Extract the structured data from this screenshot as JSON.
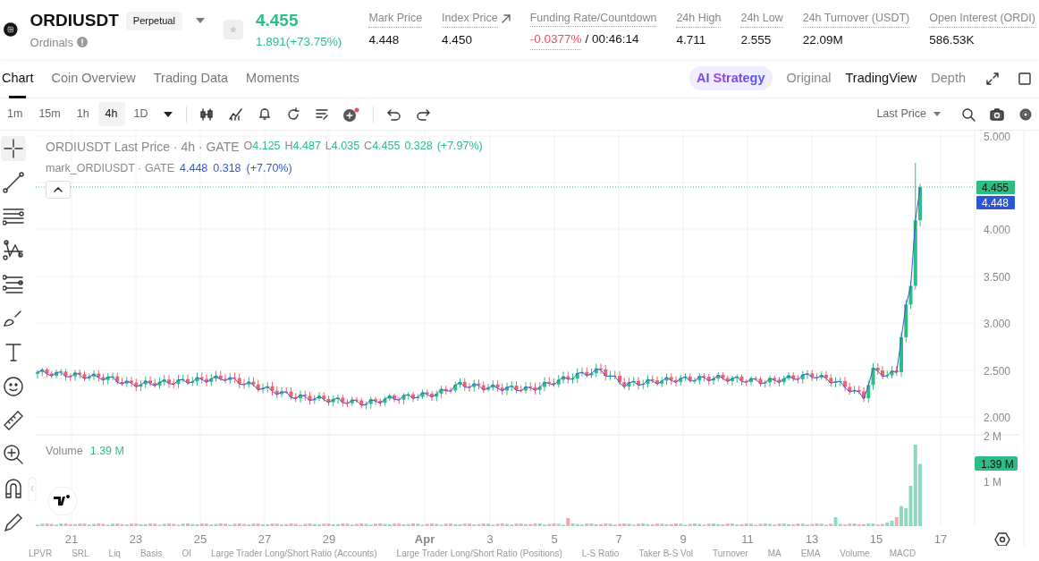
{
  "header": {
    "symbol": "ORDIUSDT",
    "badge": "Perpetual",
    "subtitle": "Ordinals",
    "price": "4.455",
    "change": "1.891(+73.75%)",
    "stats": [
      {
        "label": "Mark Price",
        "value": "4.448"
      },
      {
        "label": "Index Price",
        "value": "4.450",
        "kind": "link"
      },
      {
        "label": "Funding Rate/Countdown",
        "value": "-0.0377%",
        "extra": "/ 00:46:14",
        "kind": "funding"
      },
      {
        "label": "24h High",
        "value": "4.711"
      },
      {
        "label": "24h Low",
        "value": "2.555"
      },
      {
        "label": "24h Turnover (USDT)",
        "value": "22.09M"
      },
      {
        "label": "Open Interest (ORDI)",
        "value": "586.53K"
      }
    ]
  },
  "tabs": [
    {
      "label": "Chart",
      "selected": true
    },
    {
      "label": "Coin Overview",
      "selected": false
    },
    {
      "label": "Trading Data",
      "selected": false
    },
    {
      "label": "Moments",
      "selected": false
    }
  ],
  "strategy": {
    "icon_text": "AI",
    "label": "Strategy"
  },
  "views": [
    {
      "label": "Original",
      "selected": false
    },
    {
      "label": "TradingView",
      "selected": true
    },
    {
      "label": "Depth",
      "selected": false
    }
  ],
  "intervals": [
    {
      "label": "1m",
      "selected": false
    },
    {
      "label": "15m",
      "selected": false
    },
    {
      "label": "1h",
      "selected": false
    },
    {
      "label": "4h",
      "selected": true
    },
    {
      "label": "1D",
      "selected": false
    }
  ],
  "price_type": "Last Price",
  "legend": {
    "title": "ORDIUSDT Last Price · 4h · GATE",
    "ohlc": [
      {
        "label": "O",
        "value": "4.125"
      },
      {
        "label": "H",
        "value": "4.487"
      },
      {
        "label": "L",
        "value": "4.035"
      },
      {
        "label": "C",
        "value": "4.455"
      }
    ],
    "change": "0.328",
    "percent": "(+7.97%)",
    "mark_title": "mark_ORDIUSDT · GATE",
    "mark_value": "4.448",
    "mark_change": "0.318",
    "mark_percent": "(+7.70%)"
  },
  "price_axis": [
    "5.000",
    "4.000",
    "3.500",
    "3.000",
    "2.500",
    "2.000"
  ],
  "last_price_label": "4.455",
  "mark_price_label": "4.448",
  "volume": {
    "label": "Volume",
    "value": "1.39 M",
    "axis": [
      "2 M",
      "1 M"
    ],
    "axis_label": "1.39 M"
  },
  "date_axis": [
    {
      "label": "21",
      "bold": false
    },
    {
      "label": "23",
      "bold": false
    },
    {
      "label": "25",
      "bold": false
    },
    {
      "label": "27",
      "bold": false
    },
    {
      "label": "29",
      "bold": false
    },
    {
      "label": "Apr",
      "bold": true
    },
    {
      "label": "3",
      "bold": false
    },
    {
      "label": "5",
      "bold": false
    },
    {
      "label": "7",
      "bold": false
    },
    {
      "label": "9",
      "bold": false
    },
    {
      "label": "11",
      "bold": false
    },
    {
      "label": "13",
      "bold": false
    },
    {
      "label": "15",
      "bold": false
    },
    {
      "label": "17",
      "bold": false
    }
  ],
  "indicator_tabs": [
    "LPVR",
    "SRL",
    "Liq",
    "Basis",
    "OI",
    "Large Trader Long/Short Ratio (Accounts)",
    "Large Trader Long/Short Ratio (Positions)",
    "L-S Ratio",
    "Taker B-S Vol",
    "Turnover",
    "MA",
    "EMA",
    "Volume",
    "MACD"
  ]
}
